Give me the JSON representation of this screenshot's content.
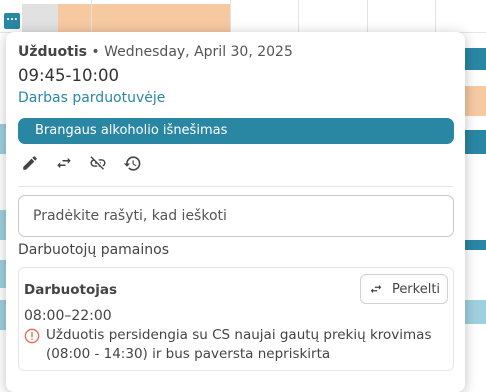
{
  "calendar": {
    "more_button_label": "..."
  },
  "popover": {
    "task_type": "Užduotis",
    "separator": " • ",
    "date": "Wednesday, April 30, 2025",
    "time_range": "09:45-10:00",
    "location": "Darbas parduotuvėje",
    "task_title": "Brangaus alkoholio išnešimas",
    "actions": [
      {
        "name": "edit-icon"
      },
      {
        "name": "swap-icon"
      },
      {
        "name": "unlink-icon"
      },
      {
        "name": "history-icon"
      }
    ],
    "search": {
      "placeholder": "Pradėkite rašyti, kad ieškoti",
      "value": ""
    },
    "section_title": "Darbuotojų pamainos",
    "shift": {
      "role": "Darbuotojas",
      "move_label": "Perkelti",
      "time": "08:00–22:00",
      "warning_line1": "Užduotis persidengia su CS naujai gautų prekių krovimas",
      "warning_line2": "(08:00 - 14:30) ir bus paversta nepriskirta"
    }
  },
  "colors": {
    "accent": "#2a87a3",
    "peach": "#f6c9a1",
    "warning": "#e06a4f"
  }
}
